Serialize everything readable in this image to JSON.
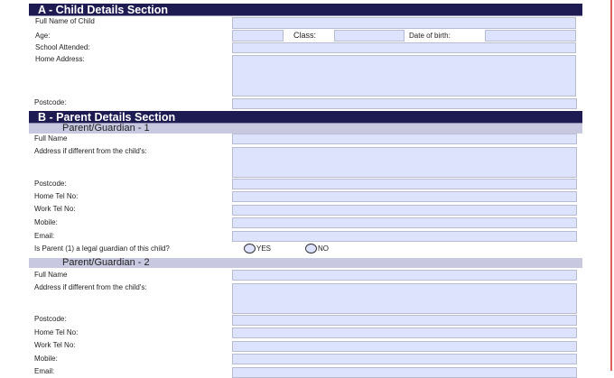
{
  "sectionA": {
    "title": "A - Child Details Section",
    "full_name": "Full Name of Child",
    "age": "Age:",
    "class": "Class:",
    "dob": "Date of birth:",
    "school": "School Attended:",
    "address": "Home Address:",
    "postcode": "Postcode:"
  },
  "sectionB": {
    "title": "B - Parent Details Section",
    "pg1": {
      "title": "Parent/Guardian - 1",
      "full_name": "Full Name",
      "address": "Address if different from the child's:",
      "postcode": "Postcode:",
      "home_tel": "Home Tel No:",
      "work_tel": "Work Tel No:",
      "mobile": "Mobile:",
      "email": "Email:",
      "legal_q": "Is Parent (1) a legal guardian of this child?",
      "yes": "YES",
      "no": "NO"
    },
    "pg2": {
      "title": "Parent/Guardian - 2",
      "full_name": "Full Name",
      "address": "Address if different from the child's:",
      "postcode": "Postcode:",
      "home_tel": "Home Tel No:",
      "work_tel": "Work Tel No:",
      "mobile": "Mobile:",
      "email": "Email:"
    }
  }
}
